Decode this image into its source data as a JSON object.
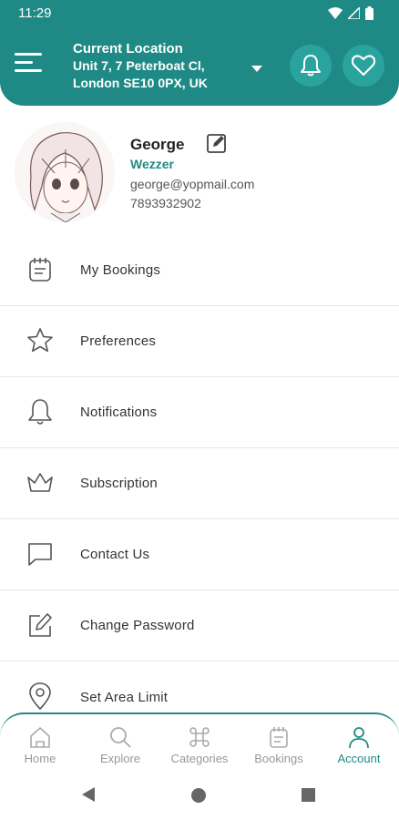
{
  "status_bar": {
    "time": "11:29",
    "icons": [
      "wifi-icon",
      "signal-icon",
      "battery-icon"
    ]
  },
  "header": {
    "location_title": "Current Location",
    "address_line1": "Unit 7, 7 Peterboat Cl,",
    "address_line2": "London SE10 0PX, UK",
    "icons": [
      "menu-icon",
      "chevron-down-icon",
      "bell-icon",
      "heart-icon"
    ]
  },
  "profile": {
    "name": "George",
    "subtitle": "Wezzer",
    "email": "george@yopmail.com",
    "phone": "7893932902"
  },
  "menu": {
    "items": [
      {
        "label": "My Bookings",
        "icon": "bookings-icon"
      },
      {
        "label": "Preferences",
        "icon": "star-icon"
      },
      {
        "label": "Notifications",
        "icon": "bell-icon"
      },
      {
        "label": "Subscription",
        "icon": "crown-icon"
      },
      {
        "label": "Contact Us",
        "icon": "chat-icon"
      },
      {
        "label": "Change Password",
        "icon": "edit-icon"
      },
      {
        "label": "Set Area Limit",
        "icon": "location-pin-icon"
      }
    ]
  },
  "bottom_nav": {
    "items": [
      {
        "label": "Home",
        "icon": "home-icon",
        "active": false
      },
      {
        "label": "Explore",
        "icon": "search-icon",
        "active": false
      },
      {
        "label": "Categories",
        "icon": "command-icon",
        "active": false
      },
      {
        "label": "Bookings",
        "icon": "bookings-icon",
        "active": false
      },
      {
        "label": "Account",
        "icon": "person-icon",
        "active": true
      }
    ]
  },
  "colors": {
    "primary": "#1f8a85",
    "primary_light": "#2aa39e",
    "text": "#333333",
    "muted": "#999999"
  }
}
